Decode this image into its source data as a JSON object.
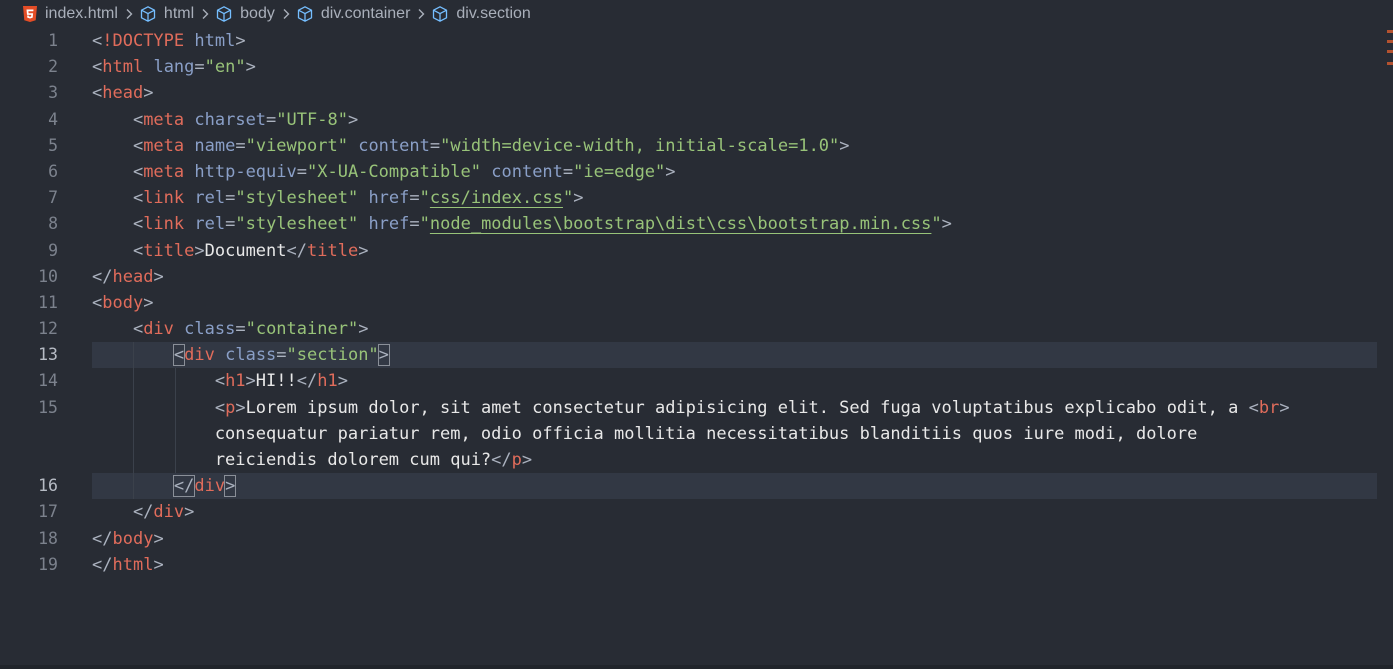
{
  "breadcrumb": {
    "items": [
      {
        "label": "index.html",
        "icon": "html5-icon"
      },
      {
        "label": "html",
        "icon": "element-cube-icon"
      },
      {
        "label": "body",
        "icon": "element-cube-icon"
      },
      {
        "label": "div.container",
        "icon": "element-cube-icon"
      },
      {
        "label": "div.section",
        "icon": "element-cube-icon"
      }
    ]
  },
  "editor": {
    "current_lines": [
      13,
      16
    ],
    "lines": [
      {
        "n": "1",
        "tokens": [
          [
            "p",
            "<"
          ],
          [
            "t",
            "!DOCTYPE"
          ],
          [
            "p",
            " "
          ],
          [
            "a",
            "html"
          ],
          [
            "p",
            ">"
          ]
        ]
      },
      {
        "n": "2",
        "tokens": [
          [
            "p",
            "<"
          ],
          [
            "t",
            "html"
          ],
          [
            "p",
            " "
          ],
          [
            "a",
            "lang"
          ],
          [
            "p",
            "="
          ],
          [
            "v",
            "\"en\""
          ],
          [
            "p",
            ">"
          ]
        ]
      },
      {
        "n": "3",
        "tokens": [
          [
            "p",
            "<"
          ],
          [
            "t",
            "head"
          ],
          [
            "p",
            ">"
          ]
        ]
      },
      {
        "n": "4",
        "tokens": [
          [
            "p",
            "    <"
          ],
          [
            "t",
            "meta"
          ],
          [
            "p",
            " "
          ],
          [
            "a",
            "charset"
          ],
          [
            "p",
            "="
          ],
          [
            "v",
            "\"UTF-8\""
          ],
          [
            "p",
            ">"
          ]
        ]
      },
      {
        "n": "5",
        "tokens": [
          [
            "p",
            "    <"
          ],
          [
            "t",
            "meta"
          ],
          [
            "p",
            " "
          ],
          [
            "a",
            "name"
          ],
          [
            "p",
            "="
          ],
          [
            "v",
            "\"viewport\""
          ],
          [
            "p",
            " "
          ],
          [
            "a",
            "content"
          ],
          [
            "p",
            "="
          ],
          [
            "v",
            "\"width=device-width, initial-scale=1.0\""
          ],
          [
            "p",
            ">"
          ]
        ]
      },
      {
        "n": "6",
        "tokens": [
          [
            "p",
            "    <"
          ],
          [
            "t",
            "meta"
          ],
          [
            "p",
            " "
          ],
          [
            "a",
            "http-equiv"
          ],
          [
            "p",
            "="
          ],
          [
            "v",
            "\"X-UA-Compatible\""
          ],
          [
            "p",
            " "
          ],
          [
            "a",
            "content"
          ],
          [
            "p",
            "="
          ],
          [
            "v",
            "\"ie=edge\""
          ],
          [
            "p",
            ">"
          ]
        ]
      },
      {
        "n": "7",
        "tokens": [
          [
            "p",
            "    <"
          ],
          [
            "t",
            "link"
          ],
          [
            "p",
            " "
          ],
          [
            "a",
            "rel"
          ],
          [
            "p",
            "="
          ],
          [
            "v",
            "\"stylesheet\""
          ],
          [
            "p",
            " "
          ],
          [
            "a",
            "href"
          ],
          [
            "p",
            "="
          ],
          [
            "v",
            "\""
          ],
          [
            "vu",
            "css/index.css"
          ],
          [
            "v",
            "\""
          ],
          [
            "p",
            ">"
          ]
        ]
      },
      {
        "n": "8",
        "tokens": [
          [
            "p",
            "    <"
          ],
          [
            "t",
            "link"
          ],
          [
            "p",
            " "
          ],
          [
            "a",
            "rel"
          ],
          [
            "p",
            "="
          ],
          [
            "v",
            "\"stylesheet\""
          ],
          [
            "p",
            " "
          ],
          [
            "a",
            "href"
          ],
          [
            "p",
            "="
          ],
          [
            "v",
            "\""
          ],
          [
            "vu",
            "node_modules\\bootstrap\\dist\\css\\bootstrap.min.css"
          ],
          [
            "v",
            "\""
          ],
          [
            "p",
            ">"
          ]
        ]
      },
      {
        "n": "9",
        "tokens": [
          [
            "p",
            "    <"
          ],
          [
            "t",
            "title"
          ],
          [
            "p",
            ">"
          ],
          [
            "x",
            "Document"
          ],
          [
            "p",
            "</"
          ],
          [
            "t",
            "title"
          ],
          [
            "p",
            ">"
          ]
        ]
      },
      {
        "n": "10",
        "tokens": [
          [
            "p",
            "</"
          ],
          [
            "t",
            "head"
          ],
          [
            "p",
            ">"
          ]
        ]
      },
      {
        "n": "11",
        "tokens": [
          [
            "p",
            "<"
          ],
          [
            "t",
            "body"
          ],
          [
            "p",
            ">"
          ]
        ]
      },
      {
        "n": "12",
        "tokens": [
          [
            "p",
            "    <"
          ],
          [
            "t",
            "div"
          ],
          [
            "p",
            " "
          ],
          [
            "a",
            "class"
          ],
          [
            "p",
            "="
          ],
          [
            "v",
            "\"container\""
          ],
          [
            "p",
            ">"
          ]
        ]
      },
      {
        "n": "13",
        "tokens": [
          [
            "p",
            "        "
          ],
          [
            "pb",
            "<"
          ],
          [
            "t",
            "div"
          ],
          [
            "p",
            " "
          ],
          [
            "a",
            "class"
          ],
          [
            "p",
            "="
          ],
          [
            "v",
            "\"section\""
          ],
          [
            "pb",
            ">"
          ]
        ]
      },
      {
        "n": "14",
        "tokens": [
          [
            "p",
            "            <"
          ],
          [
            "t",
            "h1"
          ],
          [
            "p",
            ">"
          ],
          [
            "x",
            "HI!!"
          ],
          [
            "p",
            "</"
          ],
          [
            "t",
            "h1"
          ],
          [
            "p",
            ">"
          ]
        ]
      },
      {
        "n": "15",
        "tokens": [
          [
            "p",
            "            <"
          ],
          [
            "t",
            "p"
          ],
          [
            "p",
            ">"
          ],
          [
            "x",
            "Lorem ipsum dolor, sit amet consectetur adipisicing elit. Sed fuga voluptatibus explicabo odit, a "
          ],
          [
            "p",
            "<"
          ],
          [
            "t",
            "br"
          ],
          [
            "p",
            ">"
          ]
        ]
      },
      {
        "n": "",
        "tokens": [
          [
            "x",
            "            consequatur pariatur rem, odio officia mollitia necessitatibus blanditiis quos iure modi, dolore"
          ]
        ]
      },
      {
        "n": "",
        "tokens": [
          [
            "x",
            "            reiciendis dolorem cum qui?"
          ],
          [
            "p",
            "</"
          ],
          [
            "t",
            "p"
          ],
          [
            "p",
            ">"
          ]
        ]
      },
      {
        "n": "16",
        "tokens": [
          [
            "p",
            "        "
          ],
          [
            "pb",
            "</"
          ],
          [
            "t",
            "div"
          ],
          [
            "pb",
            ">"
          ]
        ]
      },
      {
        "n": "17",
        "tokens": [
          [
            "p",
            "    </"
          ],
          [
            "t",
            "div"
          ],
          [
            "p",
            ">"
          ]
        ]
      },
      {
        "n": "18",
        "tokens": [
          [
            "p",
            "</"
          ],
          [
            "t",
            "body"
          ],
          [
            "p",
            ">"
          ]
        ]
      },
      {
        "n": "19",
        "tokens": [
          [
            "p",
            "</"
          ],
          [
            "t",
            "html"
          ],
          [
            "p",
            ">"
          ]
        ]
      }
    ]
  },
  "colors": {
    "background": "#282c34",
    "tag": "#e06c5b",
    "attribute": "#8a9fc7",
    "string": "#98c379",
    "punctuation": "#abb2bf",
    "text": "#e8e8e8",
    "line_number": "#7c828d",
    "current_line": "#323844"
  }
}
